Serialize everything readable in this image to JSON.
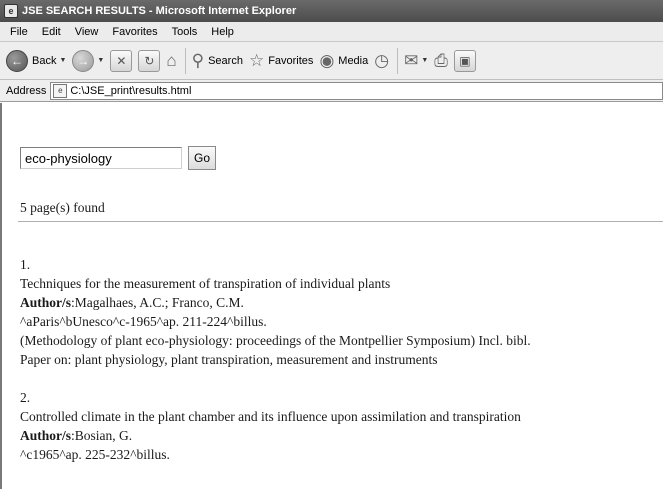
{
  "window": {
    "title": "JSE SEARCH RESULTS - Microsoft Internet Explorer"
  },
  "menu": [
    "File",
    "Edit",
    "View",
    "Favorites",
    "Tools",
    "Help"
  ],
  "toolbar": {
    "back_label": "Back",
    "search_label": "Search",
    "favorites_label": "Favorites",
    "media_label": "Media"
  },
  "address": {
    "label": "Address",
    "value": "C:\\JSE_print\\results.html"
  },
  "search": {
    "value": "eco-physiology",
    "button": "Go"
  },
  "summary": "5 page(s) found",
  "author_label": "Author/s",
  "results": [
    {
      "number": "1.",
      "title": "Techniques for the measurement of transpiration of individual plants",
      "authors": ":Magalhaes, A.C.; Franco, C.M.",
      "imprint": "^aParis^bUnesco^c-1965^ap. 211-224^billus.",
      "note": "(Methodology of plant eco-physiology: proceedings of the Montpellier Symposium) Incl. bibl.",
      "subjects": "Paper on: plant physiology, plant transpiration, measurement and instruments"
    },
    {
      "number": "2.",
      "title": "Controlled climate in the plant chamber and its influence upon assimilation and transpiration",
      "authors": ":Bosian, G.",
      "imprint": "^c1965^ap. 225-232^billus."
    }
  ]
}
